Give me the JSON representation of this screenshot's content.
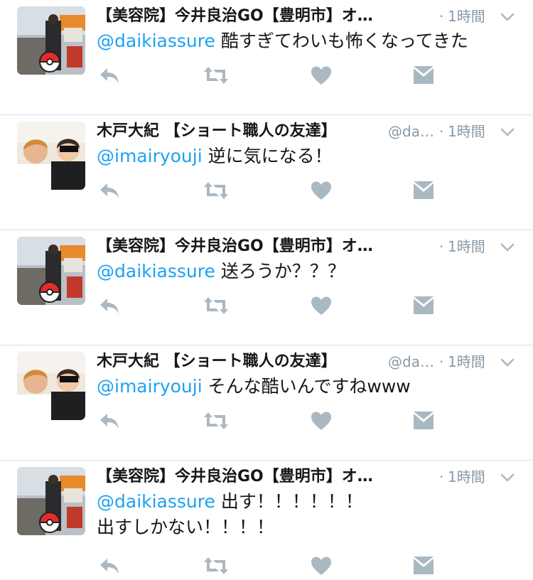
{
  "colors": {
    "mention": "#1da1f2",
    "meta": "#8899a6",
    "icon": "#aab8c2",
    "divider": "#d9dee2",
    "text": "#14171a"
  },
  "tweets": [
    {
      "avatar": "avatar-ryouji",
      "name": "【美容院】今井良治GO【豊明市】オ…",
      "handle": "",
      "dot": "·",
      "time": "1時間",
      "mention": "@daikiassure",
      "text": " 酷すぎてわいも怖くなってきた",
      "text2": ""
    },
    {
      "avatar": "avatar-daiki",
      "name": "木戸大紀 【ショート職人の友達】",
      "handle": "@da…",
      "dot": "·",
      "time": "1時間",
      "mention": "@imairyouji",
      "text": " 逆に気になる！",
      "text2": ""
    },
    {
      "avatar": "avatar-ryouji",
      "name": "【美容院】今井良治GO【豊明市】オ…",
      "handle": "",
      "dot": "·",
      "time": "1時間",
      "mention": "@daikiassure",
      "text": " 送ろうか？？？",
      "text2": ""
    },
    {
      "avatar": "avatar-daiki",
      "name": "木戸大紀 【ショート職人の友達】",
      "handle": "@da…",
      "dot": "·",
      "time": "1時間",
      "mention": "@imairyouji",
      "text": " そんな酷いんですねwww",
      "text2": ""
    },
    {
      "avatar": "avatar-ryouji",
      "name": "【美容院】今井良治GO【豊明市】オ…",
      "handle": "",
      "dot": "·",
      "time": "1時間",
      "mention": "@daikiassure",
      "text": " 出す！！！！！！",
      "text2": "出すしかない！！！！"
    }
  ],
  "action_icons": [
    "reply-icon",
    "retweet-icon",
    "like-icon",
    "direct-message-icon"
  ]
}
